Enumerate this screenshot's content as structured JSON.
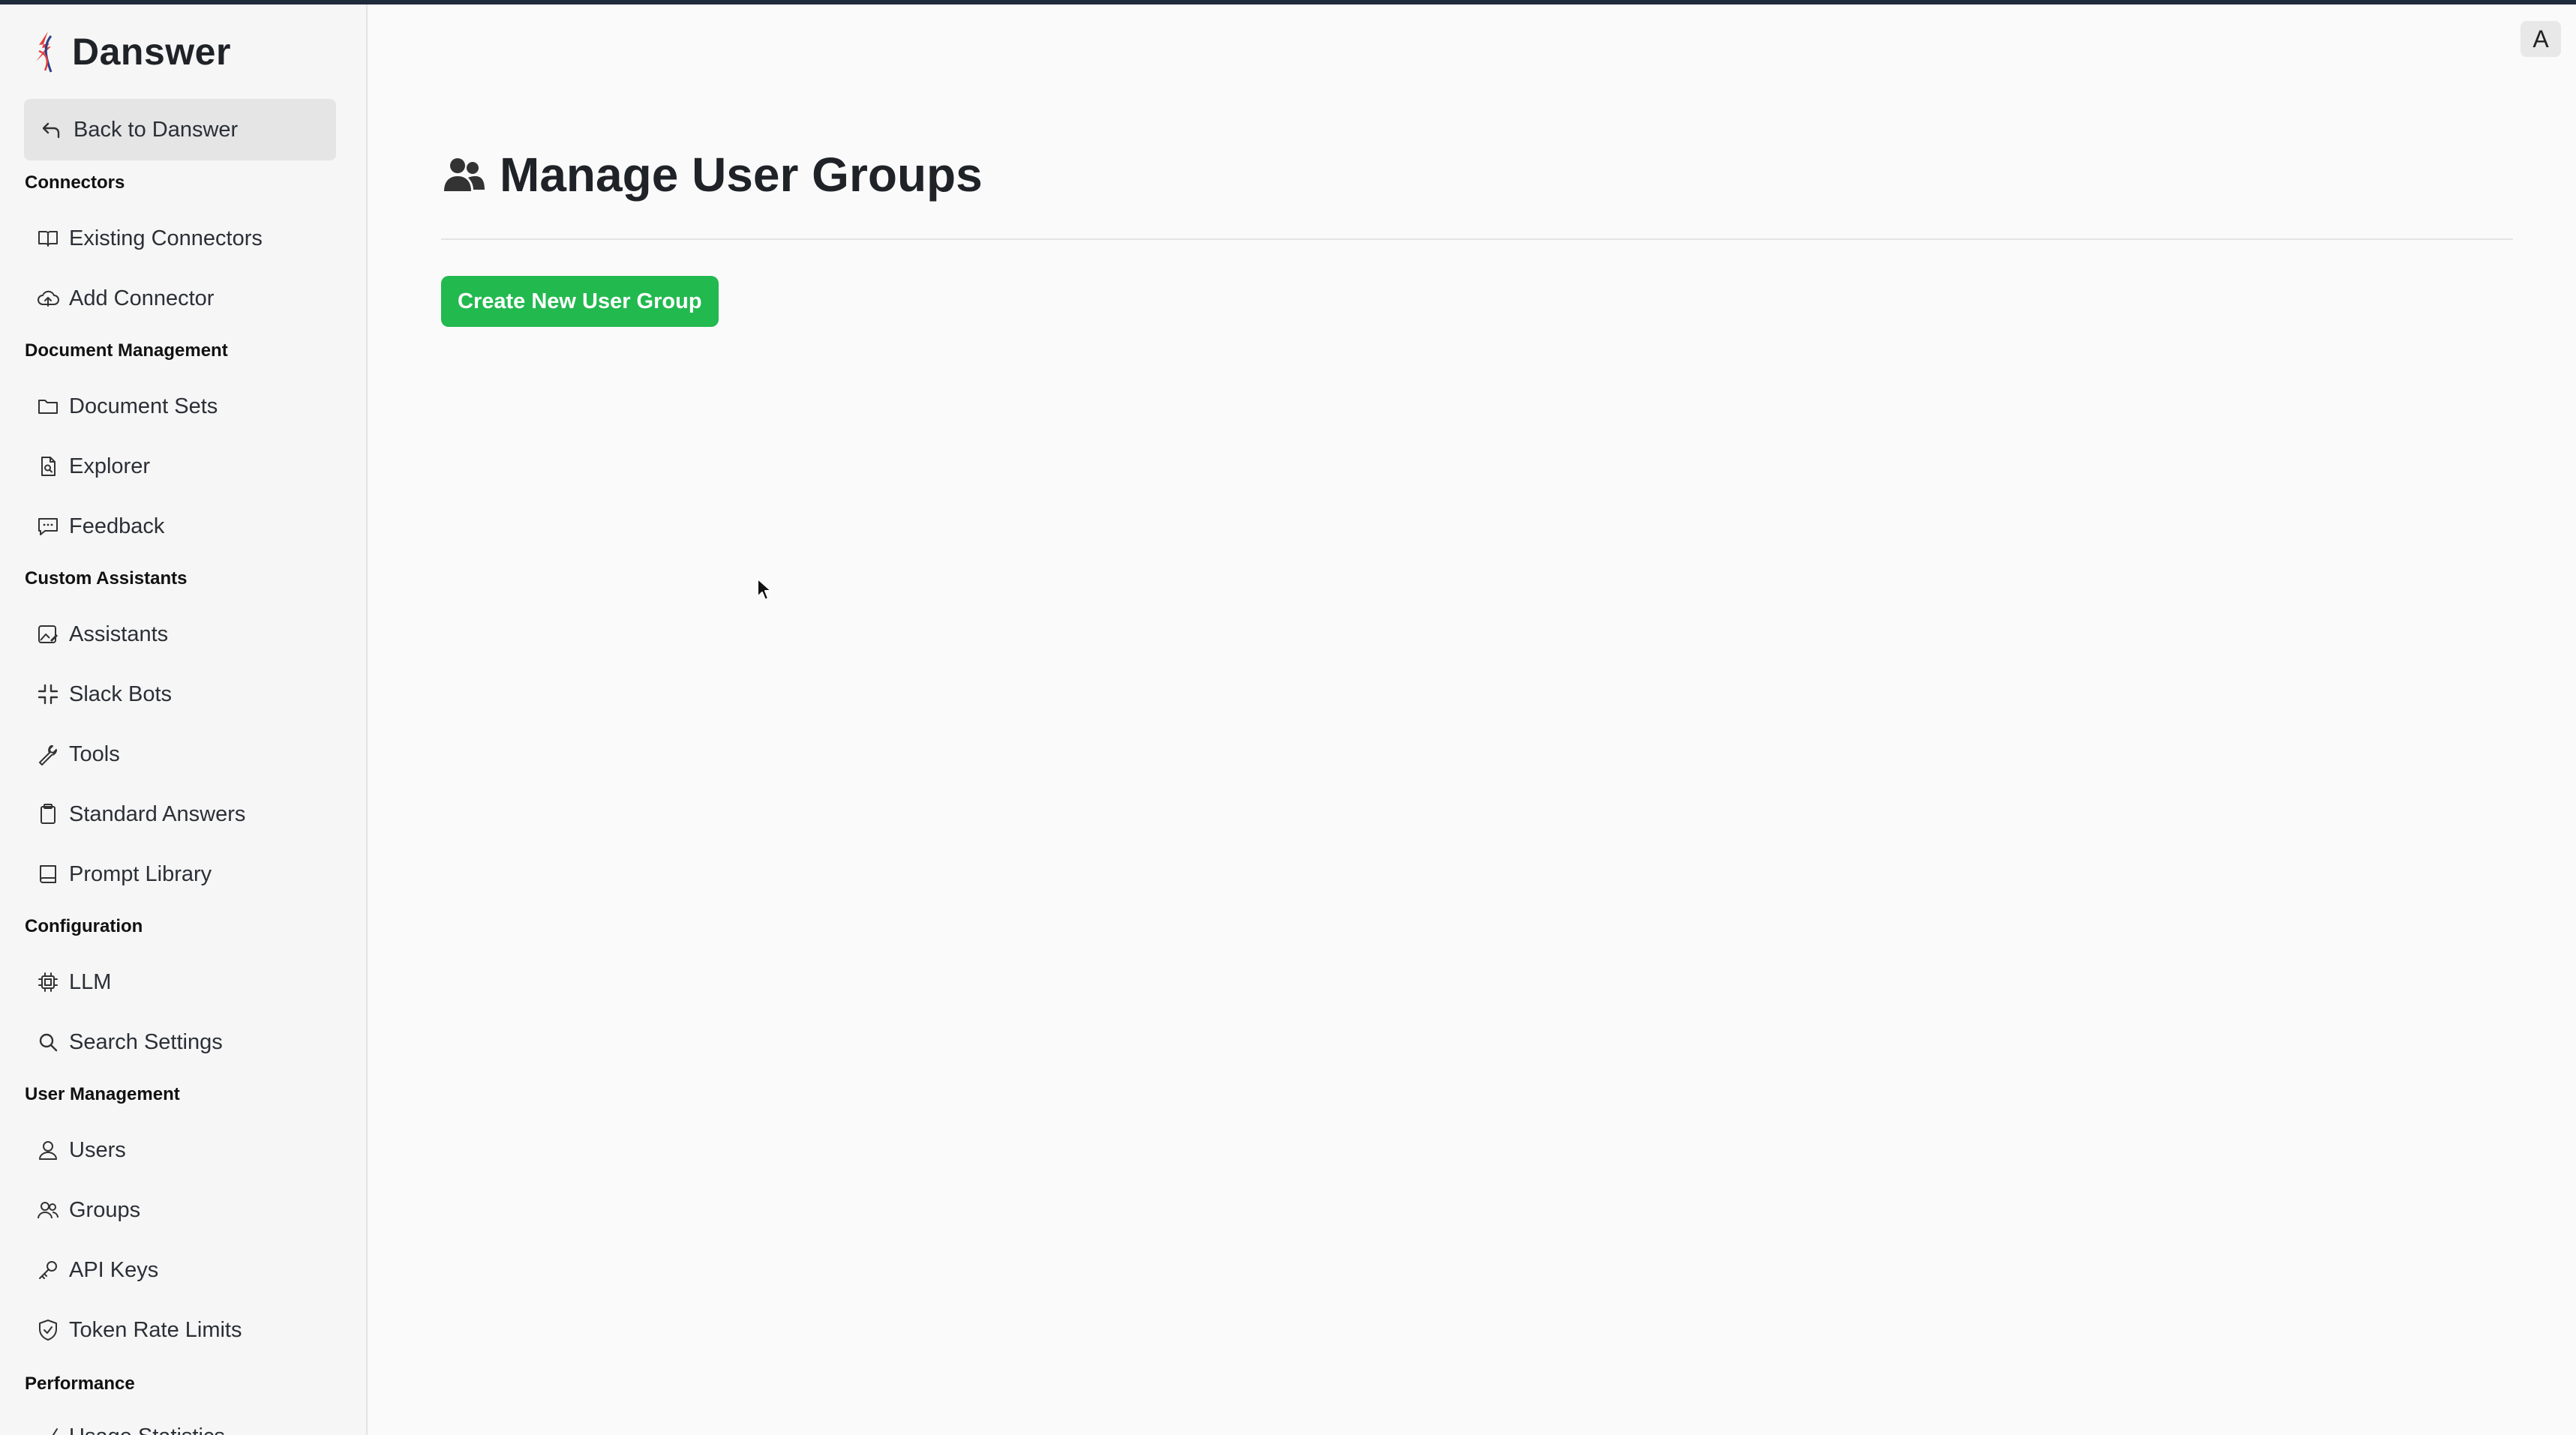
{
  "brand": {
    "name": "Danswer"
  },
  "back": {
    "label": "Back to Danswer"
  },
  "sidebar": {
    "sections": [
      {
        "title": "Connectors"
      },
      {
        "title": "Document Management"
      },
      {
        "title": "Custom Assistants"
      },
      {
        "title": "Configuration"
      },
      {
        "title": "User Management"
      },
      {
        "title": "Performance"
      }
    ],
    "items": {
      "existing_connectors": "Existing Connectors",
      "add_connector": "Add Connector",
      "document_sets": "Document Sets",
      "explorer": "Explorer",
      "feedback": "Feedback",
      "assistants": "Assistants",
      "slack_bots": "Slack Bots",
      "tools": "Tools",
      "standard_answers": "Standard Answers",
      "prompt_library": "Prompt Library",
      "llm": "LLM",
      "search_settings": "Search Settings",
      "users": "Users",
      "groups": "Groups",
      "api_keys": "API Keys",
      "token_rate_limits": "Token Rate Limits",
      "usage_statistics": "Usage Statistics"
    }
  },
  "main": {
    "title": "Manage User Groups",
    "create_button": "Create New User Group"
  },
  "user": {
    "avatar_initial": "A"
  },
  "colors": {
    "accent_green": "#22b94f",
    "top_bar": "#1f2a3a"
  },
  "icons": {
    "brand": "danswer-logo",
    "back": "arrow-back-icon",
    "page": "users-icon"
  }
}
